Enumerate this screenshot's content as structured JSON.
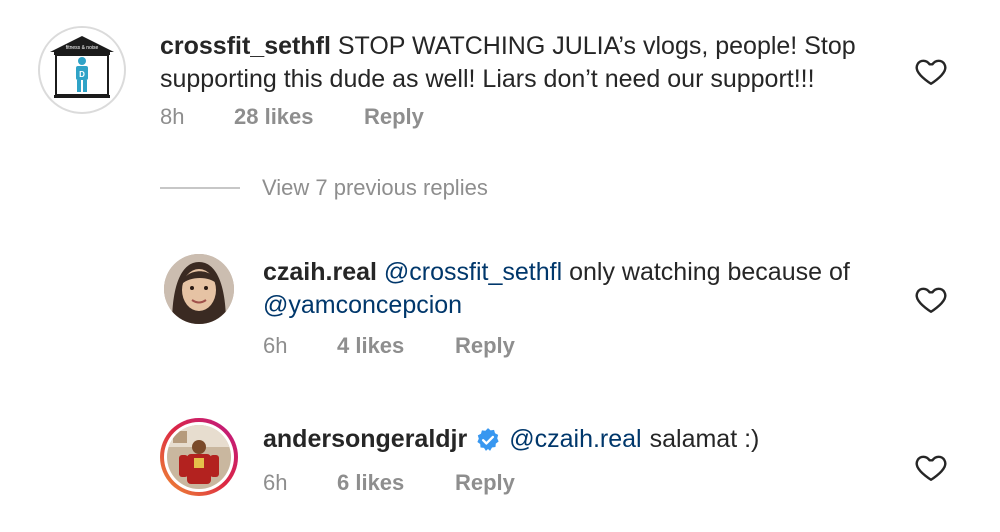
{
  "comments": [
    {
      "username": "crossfit_sethfl",
      "text": "STOP WATCHING JULIA’s vlogs, people! Stop supporting this dude as well! Liars don’t need our support!!!",
      "time": "8h",
      "likes": "28 likes",
      "reply": "Reply"
    },
    {
      "username": "czaih.real",
      "mention1": "@crossfit_sethfl",
      "text_mid": "only watching because of",
      "mention2": "@yamconcepcion",
      "time": "6h",
      "likes": "4 likes",
      "reply": "Reply"
    },
    {
      "username": "andersongeraldjr",
      "mention1": "@czaih.real",
      "text_end": "salamat :)",
      "time": "6h",
      "likes": "6 likes",
      "reply": "Reply"
    }
  ],
  "view_replies": "View 7 previous replies",
  "colors": {
    "username": "#262626",
    "mention": "#00376b",
    "meta": "#8e8e8e",
    "verified": "#3897f0",
    "story_ring": "#d6249f"
  },
  "icons": {
    "like": "heart-outline-icon",
    "verified": "verified-badge-icon"
  }
}
